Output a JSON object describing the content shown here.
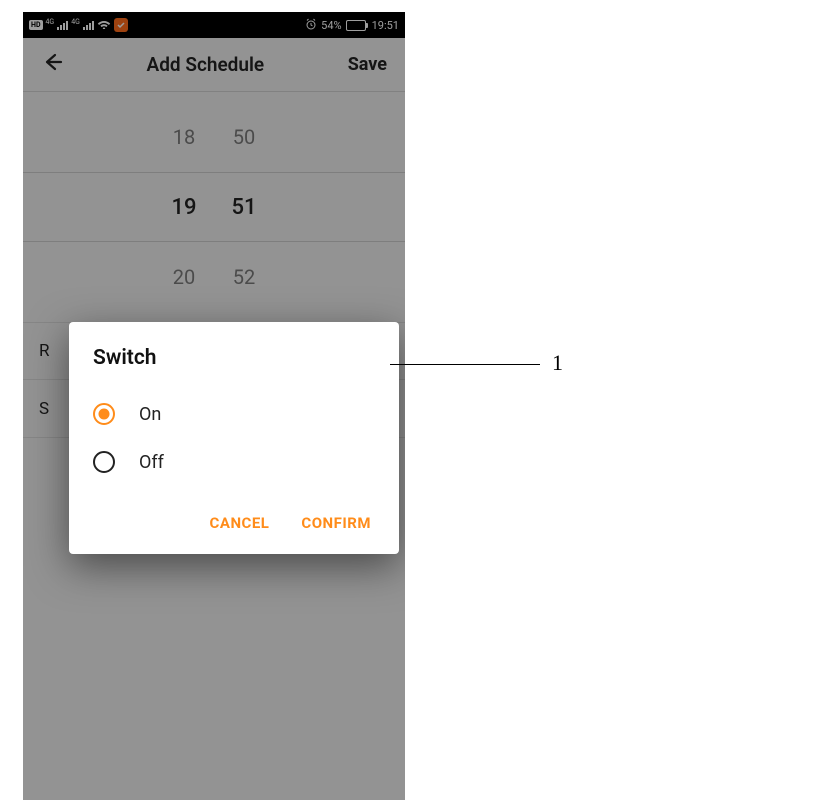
{
  "status": {
    "hd": "HD",
    "net": "4G",
    "battery_pct": "54%",
    "time": "19:51"
  },
  "header": {
    "title": "Add Schedule",
    "save": "Save"
  },
  "picker": {
    "prev_h": "18",
    "prev_m": "50",
    "sel_h": "19",
    "sel_m": "51",
    "next_h": "20",
    "next_m": "52"
  },
  "rows": {
    "repeat": "R",
    "switch": "S"
  },
  "dialog": {
    "title": "Switch",
    "option_on": "On",
    "option_off": "Off",
    "cancel": "CANCEL",
    "confirm": "CONFIRM",
    "selected": "on"
  },
  "annotation": {
    "label": "1"
  }
}
